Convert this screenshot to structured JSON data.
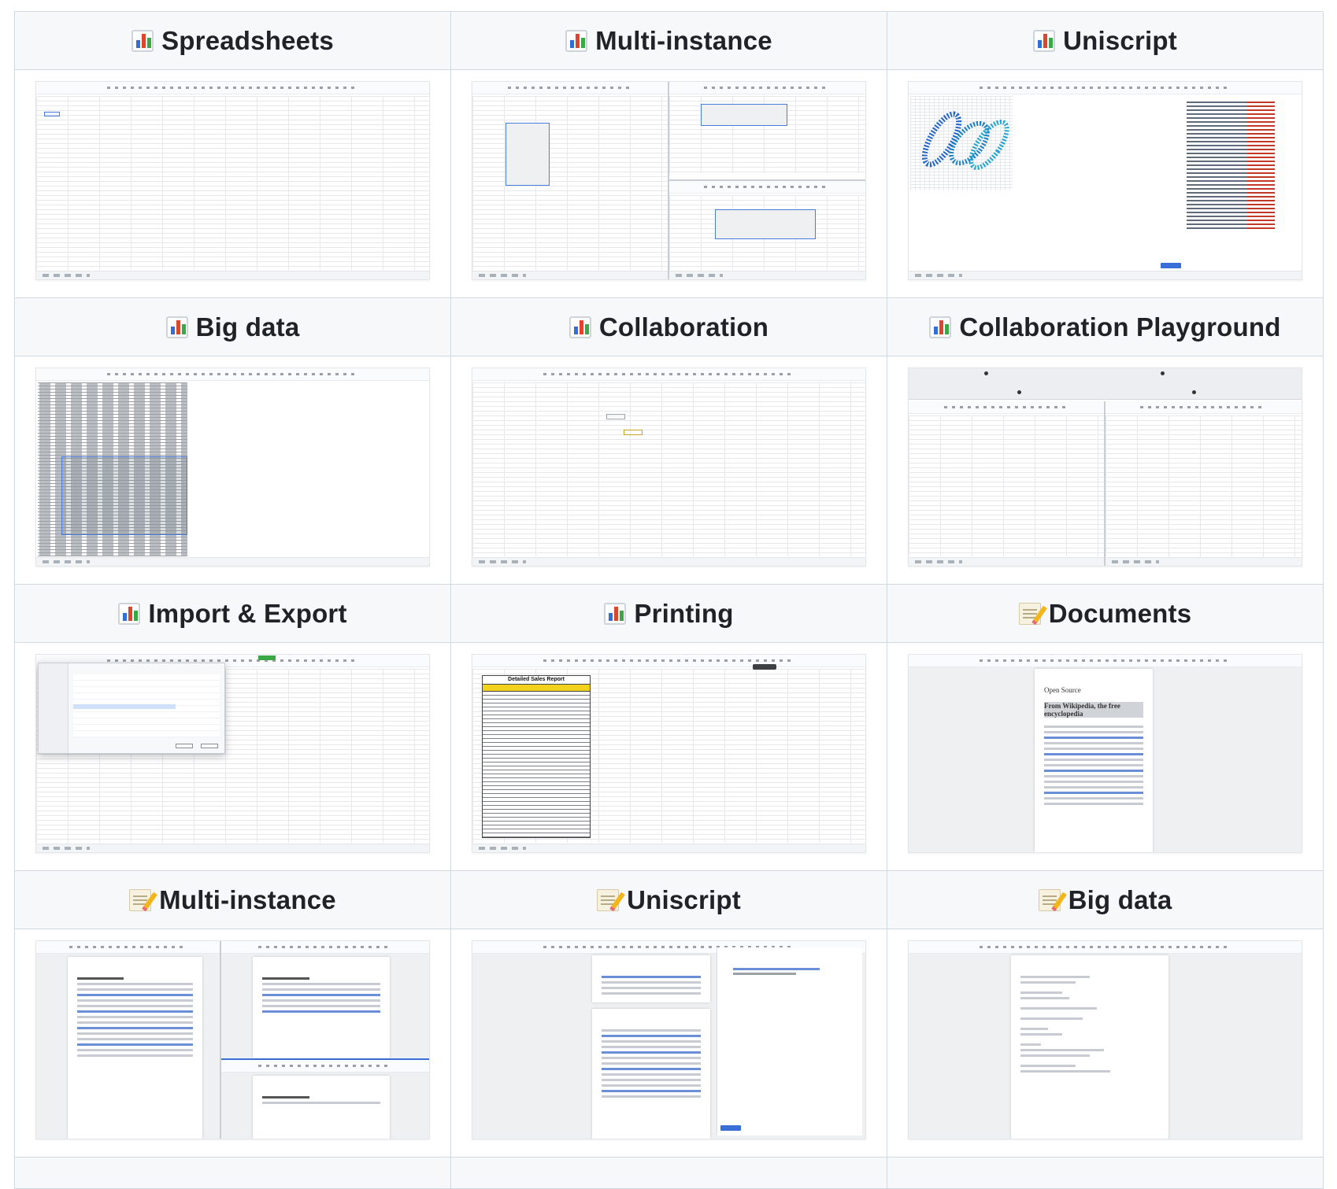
{
  "tiles": [
    {
      "title": "Spreadsheets",
      "icon": "bar-chart-icon"
    },
    {
      "title": "Multi-instance",
      "icon": "bar-chart-icon"
    },
    {
      "title": "Uniscript",
      "icon": "bar-chart-icon"
    },
    {
      "title": "Big data",
      "icon": "bar-chart-icon"
    },
    {
      "title": "Collaboration",
      "icon": "bar-chart-icon"
    },
    {
      "title": "Collaboration Playground",
      "icon": "bar-chart-icon"
    },
    {
      "title": "Import & Export",
      "icon": "bar-chart-icon"
    },
    {
      "title": "Printing",
      "icon": "bar-chart-icon"
    },
    {
      "title": "Documents",
      "icon": "memo-icon"
    },
    {
      "title": "Multi-instance",
      "icon": "memo-icon"
    },
    {
      "title": "Uniscript",
      "icon": "memo-icon"
    },
    {
      "title": "Big data",
      "icon": "memo-icon"
    }
  ],
  "previews": {
    "printing_report_title": "Detailed Sales Report",
    "doc_heading": "Open Source",
    "doc_subheading": "From Wikipedia, the free encyclopedia"
  },
  "colors": {
    "header_bg": "#f6f8fa",
    "border": "#d1d9e0",
    "selection": "#4a7ddb",
    "report_header": "#f2d21b"
  }
}
